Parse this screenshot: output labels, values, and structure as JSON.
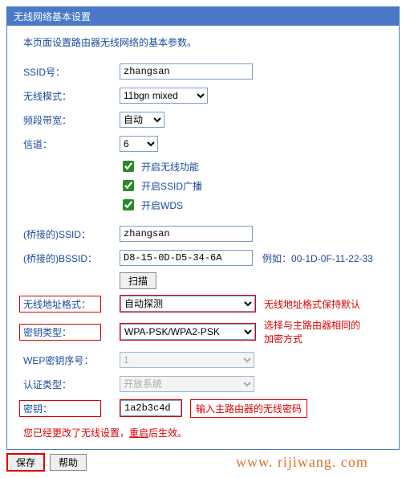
{
  "panel": {
    "title": "无线网络基本设置"
  },
  "intro": "本页面设置路由器无线网络的基本参数。",
  "labels": {
    "ssid": "SSID号：",
    "mode": "无线模式：",
    "bandwidth": "频段带宽：",
    "channel": "信道：",
    "enable_wireless": "开启无线功能",
    "enable_ssid_broadcast": "开启SSID广播",
    "enable_wds": "开启WDS",
    "bridge_ssid": "(桥接的)SSID：",
    "bridge_bssid": "(桥接的)BSSID：",
    "example_prefix": "例如：",
    "example_value": "00-1D-0F-11-22-33",
    "scan": "扫描",
    "addr_format": "无线地址格式：",
    "key_type": "密钥类型：",
    "wep_index": "WEP密钥序号：",
    "auth_type": "认证类型：",
    "key": "密钥："
  },
  "values": {
    "ssid": "zhangsan",
    "mode": "11bgn mixed",
    "bandwidth": "自动",
    "channel": "6",
    "bridge_ssid": "zhangsan",
    "bridge_bssid": "D8-15-0D-D5-34-6A",
    "addr_format": "自动探测",
    "key_type": "WPA-PSK/WPA2-PSK",
    "wep_index": "1",
    "auth_type": "开放系统",
    "key": "1a2b3c4d"
  },
  "checks": {
    "wireless": true,
    "ssid_broadcast": true,
    "wds": true
  },
  "annotations": {
    "addr_format": "无线地址格式保持默认",
    "key_type": "选择与主路由器相同的加密方式",
    "key": "输入主路由器的无线密码"
  },
  "warning": {
    "prefix": "您已经更改了无线设置，",
    "link": "重启",
    "suffix": "后生效。"
  },
  "buttons": {
    "save": "保存",
    "help": "帮助"
  },
  "watermark": "www. rijiwang. com"
}
